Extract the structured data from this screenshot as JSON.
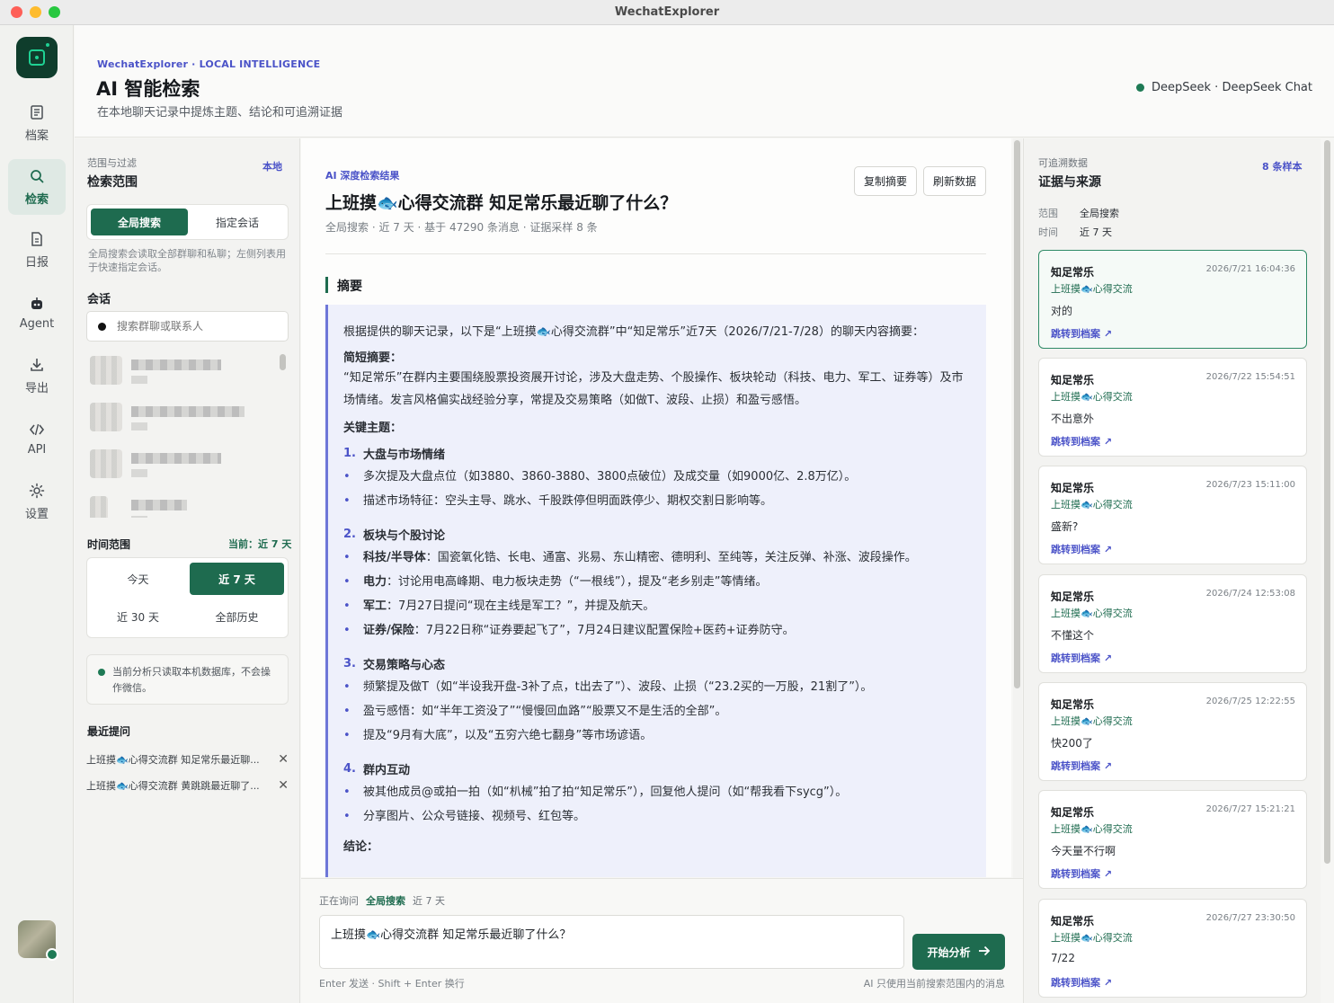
{
  "window": {
    "title": "WechatExplorer"
  },
  "nav": {
    "items": [
      {
        "label": "档案",
        "icon": "document-icon"
      },
      {
        "label": "检索",
        "icon": "search-icon"
      },
      {
        "label": "日报",
        "icon": "report-icon"
      },
      {
        "label": "Agent",
        "icon": "robot-icon"
      },
      {
        "label": "导出",
        "icon": "download-icon"
      },
      {
        "label": "API",
        "icon": "code-icon"
      },
      {
        "label": "设置",
        "icon": "gear-icon"
      }
    ],
    "active": "检索"
  },
  "header": {
    "kicker": "WechatExplorer · LOCAL INTELLIGENCE",
    "title": "AI 智能检索",
    "subtitle": "在本地聊天记录中提炼主题、结论和可追溯证据",
    "model": "DeepSeek · DeepSeek Chat"
  },
  "scope": {
    "small": "范围与过滤",
    "title": "检索范围",
    "tag": "本地",
    "mode_global": "全局搜索",
    "mode_specific": "指定会话",
    "note": "全局搜索会读取全部群聊和私聊；左侧列表用于快速指定会话。",
    "conv_label": "会话",
    "search_placeholder": "搜索群聊或联系人",
    "time_label": "时间范围",
    "time_current": "当前：近 7 天",
    "time_options": [
      "今天",
      "近 7 天",
      "近 30 天",
      "全部历史"
    ],
    "privacy": "当前分析只读取本机数据库，不会操作微信。",
    "recent_label": "最近提问",
    "recent": [
      "上班摸🐟心得交流群 知足常乐最近聊...",
      "上班摸🐟心得交流群 黄跳跳最近聊了..."
    ]
  },
  "result": {
    "kicker": "AI 深度检索结果",
    "title": "上班摸🐟心得交流群 知足常乐最近聊了什么？",
    "meta": "全局搜索 · 近 7 天 · 基于 47290 条消息 · 证据采样 8 条",
    "copy_label": "复制摘要",
    "refresh_label": "刷新数据",
    "section": "摘要",
    "intro": "根据提供的聊天记录，以下是“上班摸🐟心得交流群”中“知足常乐”近7天（2026/7/21-7/28）的聊天内容摘要：",
    "brief_h": "简短摘要：",
    "brief": "“知足常乐”在群内主要围绕股票投资展开讨论，涉及大盘走势、个股操作、板块轮动（科技、电力、军工、证券等）及市场情绪。发言风格偏实战经验分享，常提及交易策略（如做T、波段、止损）和盈亏感悟。",
    "themes_h": "关键主题：",
    "themes": [
      {
        "n": "1.",
        "title": "大盘与市场情绪",
        "items": [
          {
            "b": "",
            "t": "多次提及大盘点位（如3880、3860-3880、3800点破位）及成交量（如9000亿、2.8万亿）。"
          },
          {
            "b": "",
            "t": "描述市场特征：空头主导、跳水、千股跌停但明面跌停少、期权交割日影响等。"
          }
        ]
      },
      {
        "n": "2.",
        "title": "板块与个股讨论",
        "items": [
          {
            "b": "科技/半导体",
            "t": "：国瓷氧化锆、长电、通富、兆易、东山精密、德明利、至纯等，关注反弹、补涨、波段操作。"
          },
          {
            "b": "电力",
            "t": "：讨论用电高峰期、电力板块走势（“一根线”），提及“老乡别走”等情绪。"
          },
          {
            "b": "军工",
            "t": "：7月27日提问“现在主线是军工？”，并提及航天。"
          },
          {
            "b": "证券/保险",
            "t": "：7月22日称“证券要起飞了”，7月24日建议配置保险+医药+证券防守。"
          }
        ]
      },
      {
        "n": "3.",
        "title": "交易策略与心态",
        "items": [
          {
            "b": "",
            "t": "频繁提及做T（如“半设我开盘-3补了点，t出去了”）、波段、止损（“23.2买的一万股，21割了”）。"
          },
          {
            "b": "",
            "t": "盈亏感悟：如“半年工资没了”“慢慢回血路”“股票又不是生活的全部”。"
          },
          {
            "b": "",
            "t": "提及“9月有大底”，以及“五穷六绝七翻身”等市场谚语。"
          }
        ]
      },
      {
        "n": "4.",
        "title": "群内互动",
        "items": [
          {
            "b": "",
            "t": "被其他成员@或拍一拍（如“朳械”拍了拍“知足常乐”），回复他人提问（如“帮我看下sycg”）。"
          },
          {
            "b": "",
            "t": "分享图片、公众号链接、视频号、红包等。"
          }
        ]
      }
    ],
    "conclusion_h": "结论："
  },
  "composer": {
    "ctx_label": "正在询问",
    "ctx_scope": "全局搜索",
    "ctx_time": "近 7 天",
    "query": "上班摸🐟心得交流群 知足常乐最近聊了什么？",
    "submit_label": "开始分析",
    "hint_left": "Enter 发送 · Shift + Enter 换行",
    "hint_right": "AI 只使用当前搜索范围内的消息"
  },
  "evidence": {
    "small": "可追溯数据",
    "title": "证据与来源",
    "count": "8 条样本",
    "scope_k": "范围",
    "scope_v": "全局搜索",
    "time_k": "时间",
    "time_v": "近 7 天",
    "jump_label": "跳转到档案 ↗",
    "cards": [
      {
        "who": "知足常乐",
        "ts": "2026/7/21 16:04:36",
        "grp": "上班摸🐟心得交流",
        "msg": "对的"
      },
      {
        "who": "知足常乐",
        "ts": "2026/7/22 15:54:51",
        "grp": "上班摸🐟心得交流",
        "msg": "不出意外"
      },
      {
        "who": "知足常乐",
        "ts": "2026/7/23 15:11:00",
        "grp": "上班摸🐟心得交流",
        "msg": "盛新?"
      },
      {
        "who": "知足常乐",
        "ts": "2026/7/24 12:53:08",
        "grp": "上班摸🐟心得交流",
        "msg": "不懂这个"
      },
      {
        "who": "知足常乐",
        "ts": "2026/7/25 12:22:55",
        "grp": "上班摸🐟心得交流",
        "msg": "快200了"
      },
      {
        "who": "知足常乐",
        "ts": "2026/7/27 15:21:21",
        "grp": "上班摸🐟心得交流",
        "msg": "今天量不行啊"
      },
      {
        "who": "知足常乐",
        "ts": "2026/7/27 23:30:50",
        "grp": "上班摸🐟心得交流",
        "msg": "7/22"
      }
    ]
  }
}
